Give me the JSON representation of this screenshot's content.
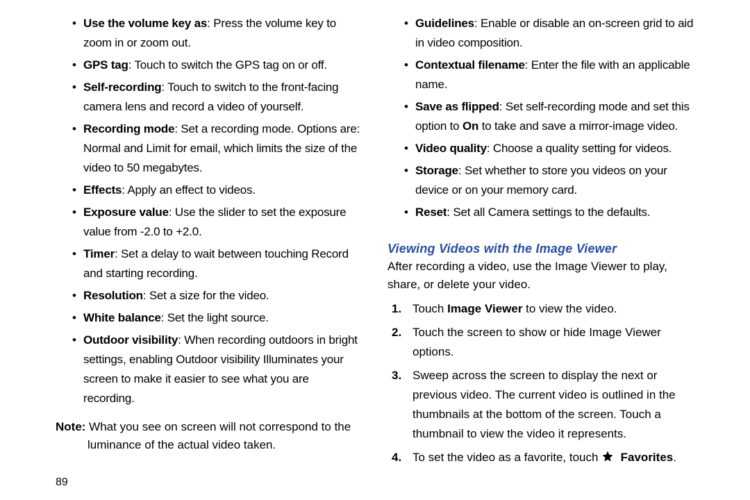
{
  "left": {
    "bullets": [
      {
        "term": "Use the volume key as",
        "text": ": Press the volume key to zoom in or zoom out."
      },
      {
        "term": "GPS tag",
        "text": ": Touch to switch the GPS tag on or off."
      },
      {
        "term": "Self-recording",
        "text": ": Touch to switch to the front-facing camera lens and record a video of yourself."
      },
      {
        "term": "Recording mode",
        "text": ": Set a recording mode. Options are: Normal and Limit for email, which limits the size of the video to 50 megabytes."
      },
      {
        "term": "Effects",
        "text": ": Apply an effect to videos."
      },
      {
        "term": "Exposure value",
        "text": ": Use the slider to set the exposure value from -2.0 to +2.0."
      },
      {
        "term": "Timer",
        "text": ": Set a delay to wait between touching Record and starting recording."
      },
      {
        "term": "Resolution",
        "text": ": Set a size for the video."
      },
      {
        "term": "White balance",
        "text": ": Set the light source."
      },
      {
        "term": "Outdoor visibility",
        "text": ": When recording outdoors in bright settings, enabling Outdoor visibility Illuminates your screen to make it easier to see what you are recording."
      }
    ],
    "noteLabel": "Note:",
    "noteText": " What you see on screen will not correspond to the luminance of the actual video taken."
  },
  "right": {
    "bullets": [
      {
        "term": "Guidelines",
        "text": ": Enable or disable an on-screen grid to aid in video composition."
      },
      {
        "term": "Contextual filename",
        "text": ":  Enter the file with an applicable name."
      },
      {
        "term": "Save as flipped",
        "preOn": ": Set self-recording mode and set this option to ",
        "on": "On",
        "postOn": " to take and save a mirror-image video."
      },
      {
        "term": "Video quality",
        "text": ": Choose a quality setting for videos."
      },
      {
        "term": "Storage",
        "text": ": Set whether to store you videos on your device or on your memory card."
      },
      {
        "term": "Reset",
        "text": ": Set all Camera settings to the defaults."
      }
    ],
    "heading": "Viewing Videos with the Image Viewer",
    "intro": "After recording a video, use the Image Viewer to play, share, or delete your video.",
    "steps": {
      "s1_pre": "Touch ",
      "s1_bold": "Image Viewer",
      "s1_post": " to view the video.",
      "s2": "Touch the screen to show or hide Image Viewer options.",
      "s3": "Sweep across the screen to display the next or previous video. The current video is outlined in the thumbnails at the bottom of the screen. Touch a thumbnail to view the video it represents.",
      "s4_pre": "To set the video as a favorite, touch ",
      "s4_bold": "Favorites",
      "s4_post": "."
    }
  },
  "pageNumber": "89"
}
